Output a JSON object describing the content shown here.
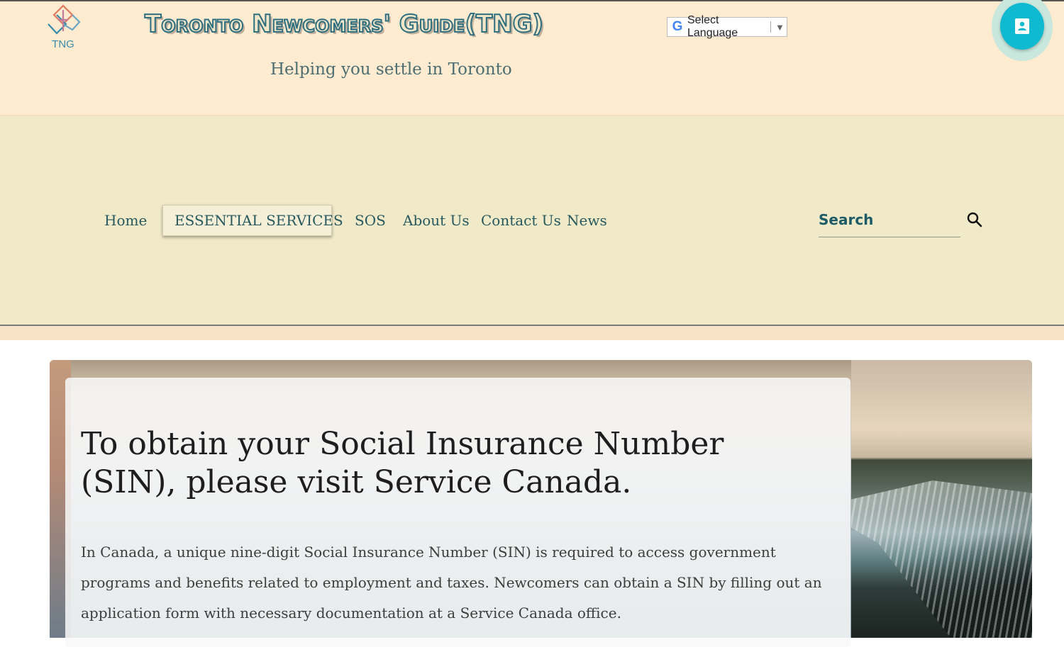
{
  "header": {
    "logo_text": "TNG",
    "site_title": "Toronto Newcomers' Guide(TNG)",
    "tagline": "Helping you settle in Toronto",
    "language_selector": {
      "label": "Select Language"
    }
  },
  "nav": {
    "items": [
      {
        "label": "Home"
      },
      {
        "label": "ESSENTIAL SERVICES",
        "active": true
      },
      {
        "label": "SOS"
      },
      {
        "label": "About Us"
      },
      {
        "label": "Contact Us"
      },
      {
        "label": "News"
      }
    ],
    "search": {
      "placeholder": "Search"
    }
  },
  "hero": {
    "title": "To obtain your Social Insurance Number (SIN), please visit Service Canada.",
    "body": "In Canada, a unique nine-digit Social Insurance Number (SIN) is required to access government programs and benefits related to employment and taxes. Newcomers can obtain a SIN by filling out an application form with necessary documentation at a Service Canada office."
  },
  "colors": {
    "header_bg": "#feebd0",
    "nav_bg": "#f1eac9",
    "accent_teal": "#0fbad0",
    "nav_text": "#27595f"
  }
}
